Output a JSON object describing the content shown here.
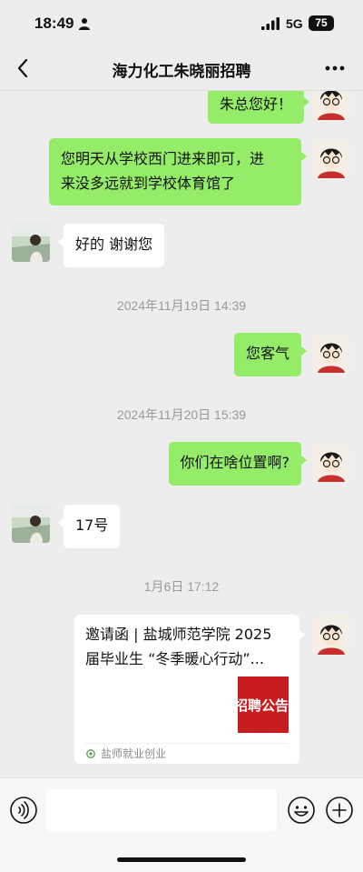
{
  "status_bar": {
    "time": "18:49",
    "network": "5G",
    "battery": "75"
  },
  "header": {
    "title": "海力化工朱晓丽招聘",
    "back_icon": "chevron-left-icon",
    "more_icon": "more-dots-icon"
  },
  "messages": [
    {
      "sender": "self",
      "text": "朱总您好！"
    },
    {
      "sender": "self",
      "lines": [
        "您明天从学校西门进来即可，进",
        "来没多远就到学校体育馆了"
      ]
    },
    {
      "sender": "other",
      "text": "好的 谢谢您"
    },
    {
      "type": "timestamp",
      "text": "2024年11月19日 14:39"
    },
    {
      "sender": "self",
      "text": "您客气"
    },
    {
      "type": "timestamp",
      "text": "2024年11月20日 15:39"
    },
    {
      "sender": "self",
      "text": "你们在啥位置啊?"
    },
    {
      "sender": "other",
      "text": "17号"
    },
    {
      "type": "timestamp",
      "text": "1月6日 17:12"
    },
    {
      "sender": "self",
      "type": "link_card",
      "title_lines": [
        "邀请函 | 盐城师范学院 2025",
        "届毕业生 “冬季暖心行动”..."
      ],
      "thumb_text": "招聘公告",
      "source": "盐师就业创业"
    }
  ],
  "input_bar": {
    "placeholder": "",
    "voice_icon": "voice-icon",
    "emoji_icon": "emoji-icon",
    "plus_icon": "plus-icon"
  },
  "colors": {
    "background": "#ededed",
    "self_bubble": "#95ec69",
    "other_bubble": "#ffffff",
    "timestamp": "#9a9a9a",
    "thumb_red": "#c81d20"
  }
}
